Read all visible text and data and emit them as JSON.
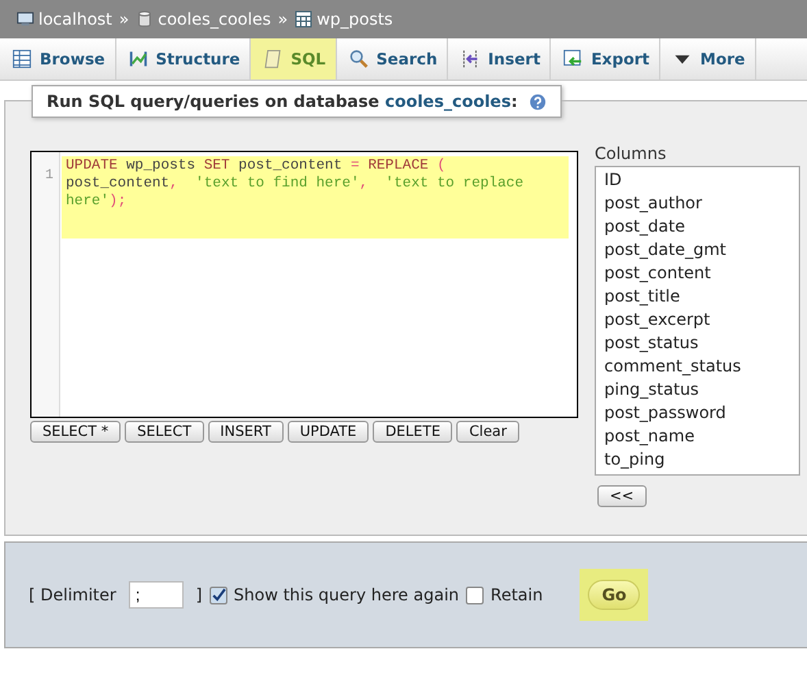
{
  "breadcrumb": [
    {
      "label": "localhost",
      "kind": "server"
    },
    {
      "label": "cooles_cooles",
      "kind": "database"
    },
    {
      "label": "wp_posts",
      "kind": "table"
    }
  ],
  "breadcrumb_separator": "»",
  "tabs": [
    {
      "label": "Browse",
      "kind": "browse",
      "selected": false
    },
    {
      "label": "Structure",
      "kind": "structure",
      "selected": false
    },
    {
      "label": "SQL",
      "kind": "sql",
      "selected": true
    },
    {
      "label": "Search",
      "kind": "search",
      "selected": false
    },
    {
      "label": "Insert",
      "kind": "insert",
      "selected": false
    },
    {
      "label": "Export",
      "kind": "export",
      "selected": false
    },
    {
      "label": "More",
      "kind": "more",
      "selected": false
    }
  ],
  "legend": {
    "text": "Run SQL query/queries on database ",
    "database": "cooles_cooles",
    "suffix": ":"
  },
  "editor": {
    "line_number": "1",
    "highlighted": true,
    "tokens": [
      {
        "text": "UPDATE",
        "kind": "keyword"
      },
      {
        "text": " wp_posts ",
        "kind": "ident"
      },
      {
        "text": "SET",
        "kind": "keyword"
      },
      {
        "text": " post_content ",
        "kind": "ident"
      },
      {
        "text": "=",
        "kind": "operator"
      },
      {
        "text": " REPLACE",
        "kind": "keyword"
      },
      {
        "text": " (",
        "kind": "operator"
      },
      {
        "text": " post_content",
        "kind": "ident"
      },
      {
        "text": ",",
        "kind": "operator"
      },
      {
        "text": "  'text to find here'",
        "kind": "string"
      },
      {
        "text": ",",
        "kind": "operator"
      },
      {
        "text": "  'text to replace here'",
        "kind": "string"
      },
      {
        "text": ");",
        "kind": "operator"
      }
    ]
  },
  "query_buttons": [
    "SELECT *",
    "SELECT",
    "INSERT",
    "UPDATE",
    "DELETE",
    "Clear"
  ],
  "columns": {
    "label": "Columns",
    "items": [
      "ID",
      "post_author",
      "post_date",
      "post_date_gmt",
      "post_content",
      "post_title",
      "post_excerpt",
      "post_status",
      "comment_status",
      "ping_status",
      "post_password",
      "post_name",
      "to_ping"
    ],
    "insert_button": "<<"
  },
  "footer": {
    "delimiter_open": "[ Delimiter",
    "delimiter_value": ";",
    "delimiter_close": "]",
    "show_again": {
      "label": "Show this query here again",
      "checked": true
    },
    "retain": {
      "label": "Retain",
      "checked": false
    },
    "go_button": {
      "label": "Go",
      "highlighted": true
    }
  }
}
